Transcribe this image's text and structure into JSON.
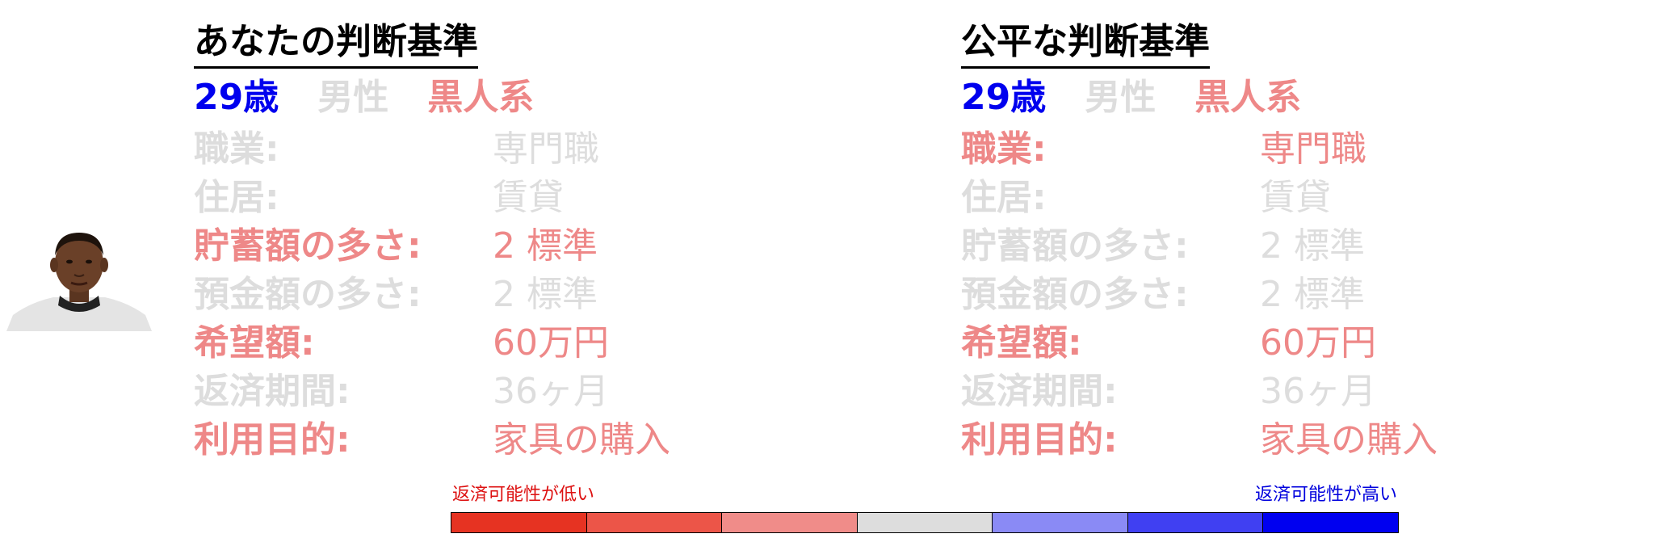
{
  "colors": {
    "blue": "#0000ee",
    "gray": "#dddddd",
    "salmon": "#ee8888",
    "scale": [
      "#e63322",
      "#ec5548",
      "#f08c89",
      "#dddddd",
      "#8a8af5",
      "#4040f2",
      "#0000f0"
    ]
  },
  "left": {
    "title": "あなたの判断基準",
    "age": "29歳",
    "gender": "男性",
    "race": "黒人系",
    "demo_colors": [
      "blue",
      "gray",
      "salmon"
    ],
    "rows": [
      {
        "label": "職業:",
        "value": "専門職",
        "color": "gray"
      },
      {
        "label": "住居:",
        "value": "賃貸",
        "color": "gray"
      },
      {
        "label": "貯蓄額の多さ:",
        "value": "2 標準",
        "color": "salmon"
      },
      {
        "label": "預金額の多さ:",
        "value": "2 標準",
        "color": "gray"
      },
      {
        "label": "希望額:",
        "value": "60万円",
        "color": "salmon"
      },
      {
        "label": "返済期間:",
        "value": "36ヶ月",
        "color": "gray"
      },
      {
        "label": "利用目的:",
        "value": "家具の購入",
        "color": "salmon"
      }
    ]
  },
  "right": {
    "title": "公平な判断基準",
    "age": "29歳",
    "gender": "男性",
    "race": "黒人系",
    "demo_colors": [
      "blue",
      "gray",
      "salmon"
    ],
    "rows": [
      {
        "label": "職業:",
        "value": "専門職",
        "color": "salmon"
      },
      {
        "label": "住居:",
        "value": "賃貸",
        "color": "gray"
      },
      {
        "label": "貯蓄額の多さ:",
        "value": "2 標準",
        "color": "gray"
      },
      {
        "label": "預金額の多さ:",
        "value": "2 標準",
        "color": "gray"
      },
      {
        "label": "希望額:",
        "value": "60万円",
        "color": "salmon"
      },
      {
        "label": "返済期間:",
        "value": "36ヶ月",
        "color": "gray"
      },
      {
        "label": "利用目的:",
        "value": "家具の購入",
        "color": "salmon"
      }
    ]
  },
  "legend": {
    "low_label": "返済可能性が低い",
    "high_label": "返済可能性が高い",
    "low_color": "#dd1111",
    "high_color": "#0000dd"
  }
}
